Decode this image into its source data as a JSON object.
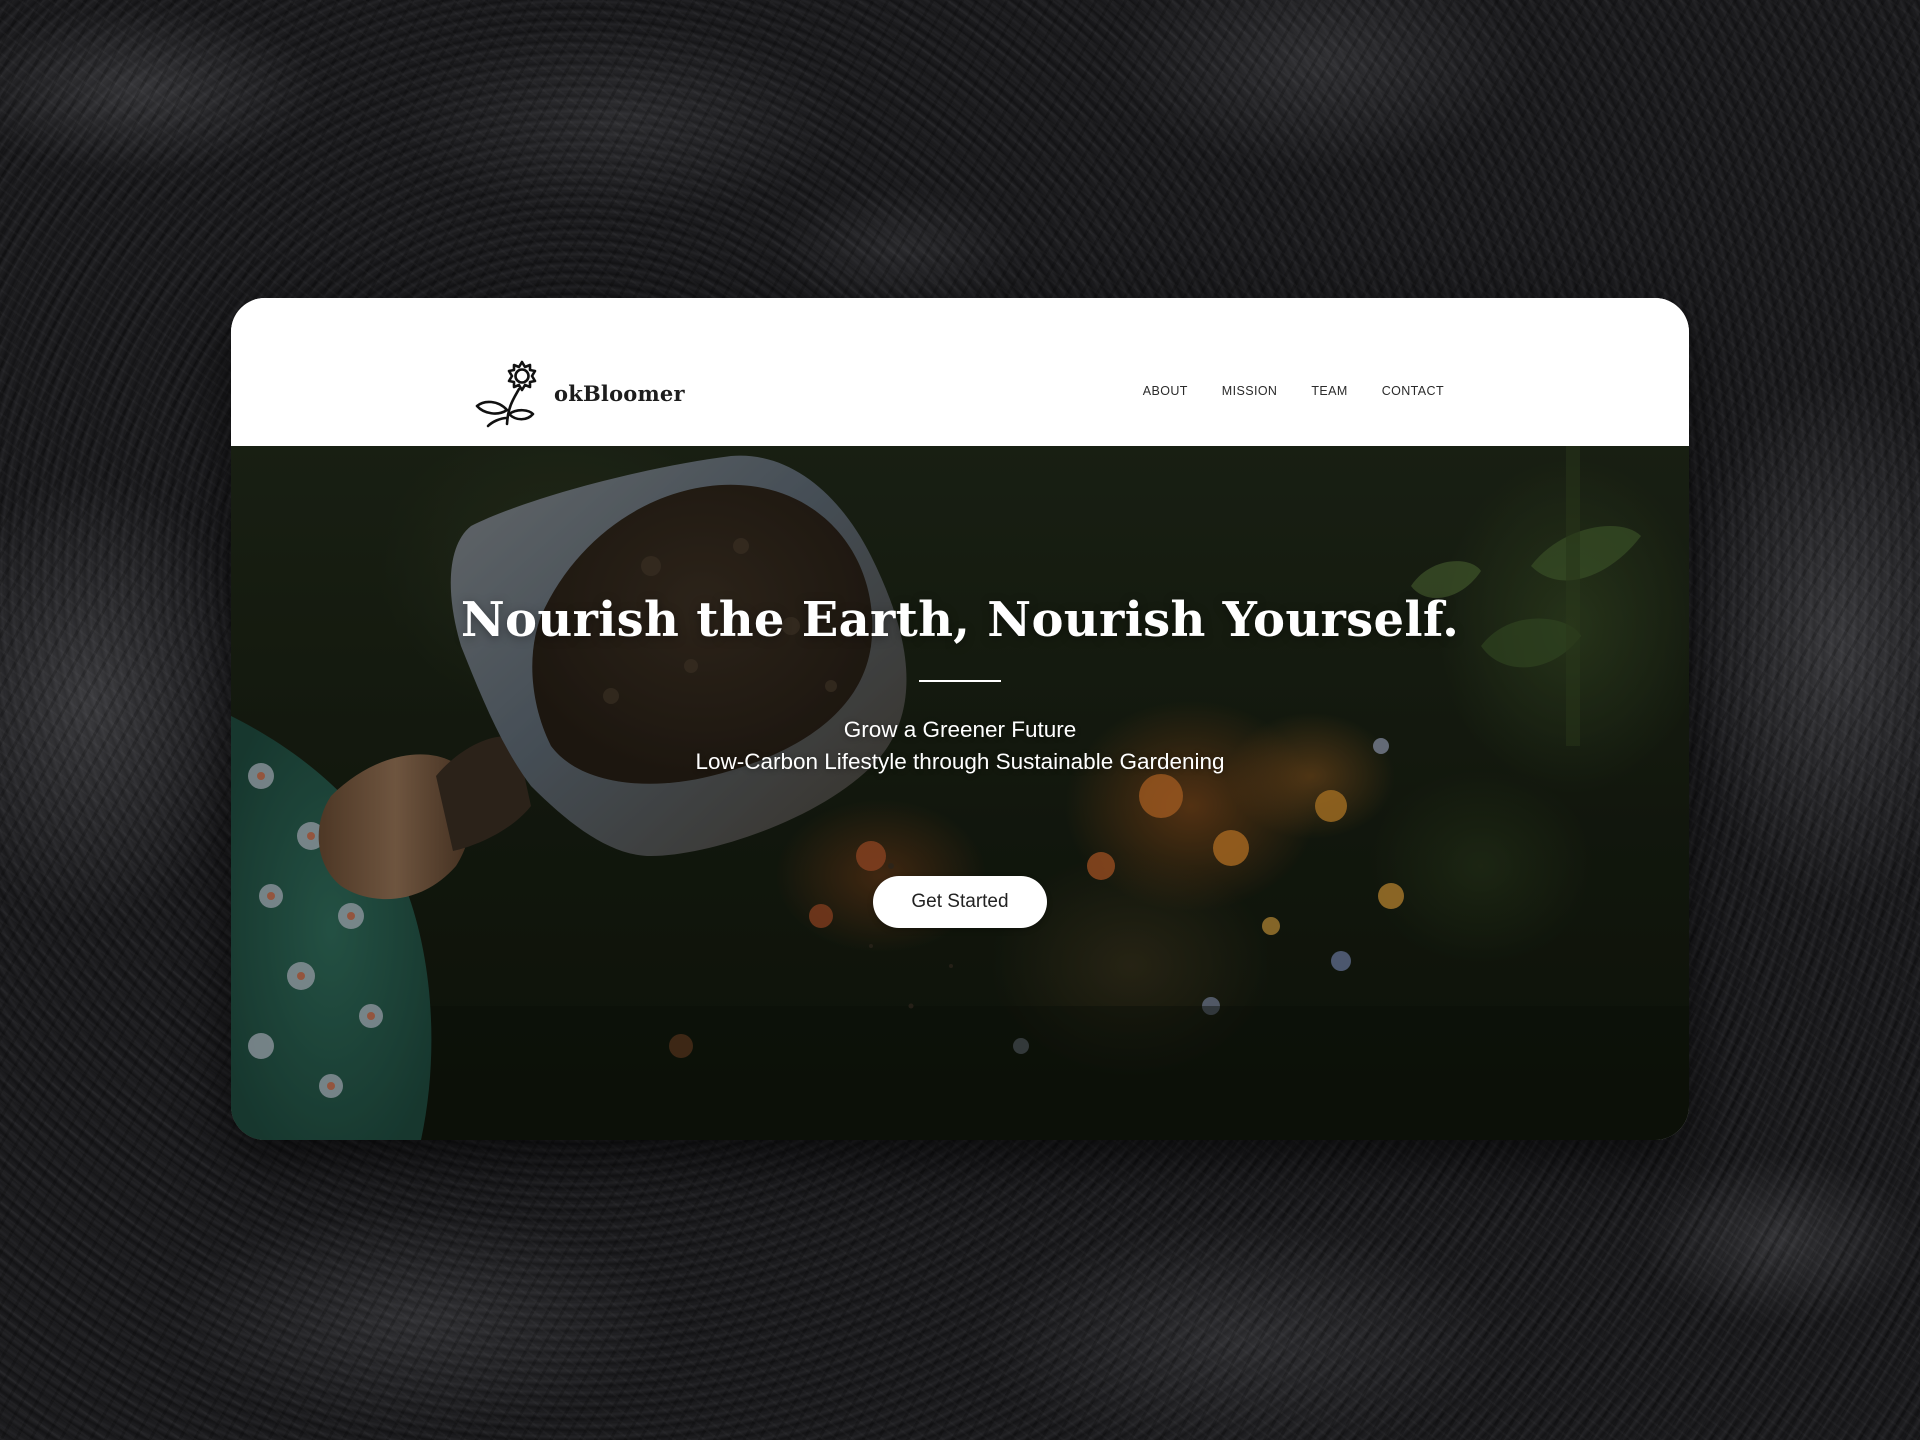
{
  "brand": {
    "name": "okBloomer",
    "logo_icon": "flower-sprout-icon"
  },
  "nav": {
    "links": [
      {
        "label": "ABOUT"
      },
      {
        "label": "MISSION"
      },
      {
        "label": "TEAM"
      },
      {
        "label": "CONTACT"
      }
    ]
  },
  "hero": {
    "title": "Nourish the Earth, Nourish Yourself.",
    "subtitle_line1": "Grow a Greener Future",
    "subtitle_line2": "Low-Carbon Lifestyle through Sustainable Gardening",
    "cta_label": "Get Started",
    "background_image": "trowel-with-soil-and-flowers-photo"
  },
  "colors": {
    "page_background": "#161618",
    "navbar_background": "#ffffff",
    "text_dark": "#1d1d1d",
    "hero_text": "#ffffff",
    "button_background": "#ffffff"
  }
}
